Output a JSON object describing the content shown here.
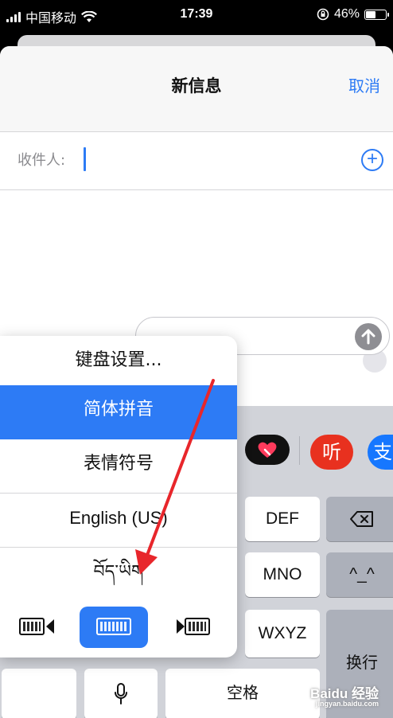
{
  "status_bar": {
    "carrier": "中国移动",
    "time": "17:39",
    "battery": "46%",
    "battery_level": 0.46
  },
  "nav": {
    "title": "新信息",
    "cancel": "取消"
  },
  "recipient": {
    "label": "收件人:"
  },
  "send_icon": "arrow-up-icon",
  "app_strip": {
    "ting_label": "听",
    "alipay_label": "支"
  },
  "keyboard": {
    "def": "DEF",
    "mno": "MNO",
    "wxyz": "WXYZ",
    "emoticon": "^_^",
    "newline": "换行",
    "space": "空格"
  },
  "input_menu": {
    "items": [
      "键盘设置...",
      "简体拼音",
      "表情符号",
      "English (US)",
      "བོད་ཡིག"
    ],
    "selected": "简体拼音"
  },
  "watermark": {
    "brand": "Baidu 经验",
    "url": "jingyan.baidu.com"
  },
  "colors": {
    "accent": "#2d7bf5",
    "arrow": "#e8262b"
  }
}
